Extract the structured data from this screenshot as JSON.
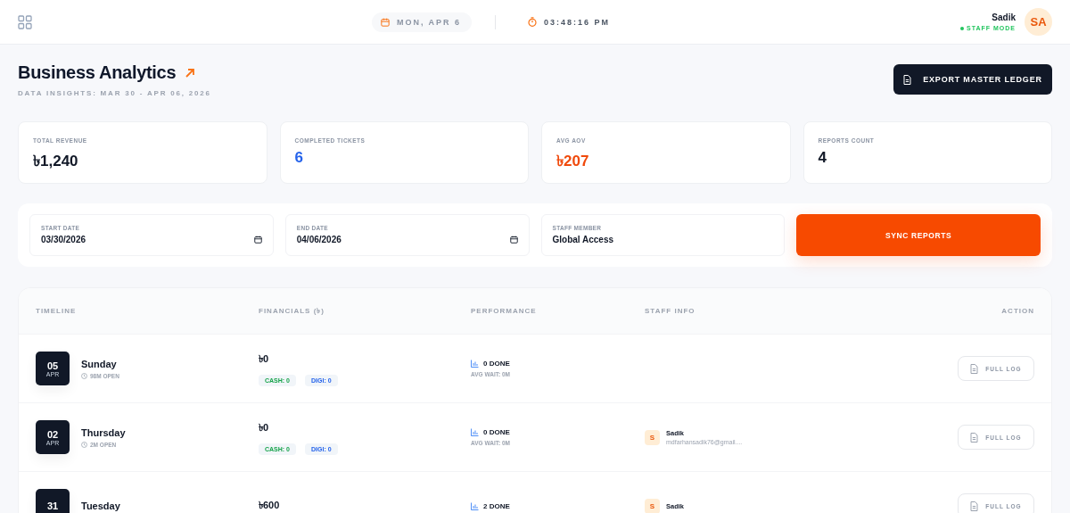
{
  "header": {
    "date": "MON, APR 6",
    "time": "03:48:16 PM",
    "user": {
      "name": "Sadik",
      "mode": "STAFF MODE",
      "initials": "SA"
    }
  },
  "page": {
    "title": "Business Analytics",
    "subtitle": "DATA INSIGHTS: MAR 30 - APR 06, 2026",
    "export_button": "EXPORT MASTER LEDGER"
  },
  "stats": [
    {
      "label": "TOTAL REVENUE",
      "value": "৳1,240",
      "color": "#111827"
    },
    {
      "label": "COMPLETED TICKETS",
      "value": "6",
      "color": "#2563eb"
    },
    {
      "label": "AVG AOV",
      "value": "৳207",
      "color": "#f04a0c"
    },
    {
      "label": "REPORTS COUNT",
      "value": "4",
      "color": "#111827"
    }
  ],
  "filters": {
    "fields": [
      {
        "kind": "date",
        "label": "START DATE",
        "value": "03/30/2026"
      },
      {
        "kind": "date",
        "label": "END DATE",
        "value": "04/06/2026"
      },
      {
        "kind": "select",
        "label": "STAFF MEMBER",
        "value": "Global Access"
      }
    ],
    "button": "SYNC REPORTS"
  },
  "table": {
    "columns": [
      "TIMELINE",
      "FINANCIALS (৳)",
      "PERFORMANCE",
      "STAFF INFO",
      "ACTION"
    ],
    "rows": [
      {
        "day": "05",
        "month": "APR",
        "weekday": "Sunday",
        "open": "98M OPEN",
        "amount": "৳0",
        "cash": "CASH: 0",
        "digi": "DIGI: 0",
        "done": "0 DONE",
        "wait": "AVG WAIT: 0M",
        "action": "FULL LOG"
      },
      {
        "day": "02",
        "month": "APR",
        "weekday": "Thursday",
        "open": "2M OPEN",
        "amount": "৳0",
        "cash": "CASH: 0",
        "digi": "DIGI: 0",
        "done": "0 DONE",
        "wait": "AVG WAIT: 0M",
        "staff": {
          "initial": "S",
          "name": "Sadik",
          "email": "mdfarhansadik76@gmail...."
        },
        "action": "FULL LOG"
      },
      {
        "day": "31",
        "weekday": "Tuesday",
        "amount": "৳600",
        "done": "2 DONE",
        "staff": {
          "initial": "S",
          "name": "Sadik"
        },
        "action": "FULL LOG"
      }
    ]
  }
}
